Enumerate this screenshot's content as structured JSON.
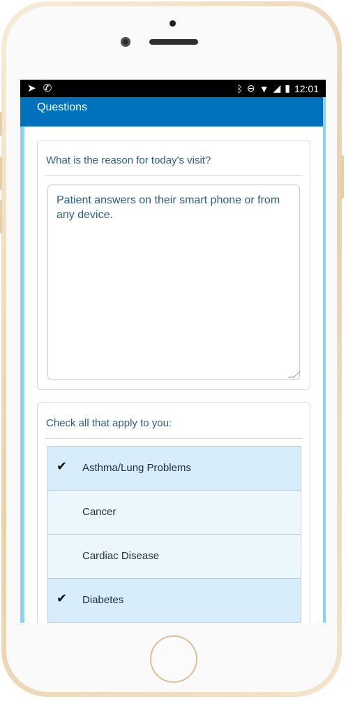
{
  "status_bar": {
    "time": "12:01"
  },
  "app_bar": {
    "title": "Questions"
  },
  "visit_reason": {
    "question": "What is the reason for today's visit?",
    "answer": "Patient answers on their smart phone or from any device."
  },
  "conditions": {
    "question": "Check all that apply to you:",
    "items": [
      {
        "label": "Asthma/Lung Problems",
        "checked": true
      },
      {
        "label": "Cancer",
        "checked": false
      },
      {
        "label": "Cardiac Disease",
        "checked": false
      },
      {
        "label": "Diabetes",
        "checked": true
      }
    ]
  },
  "colors": {
    "app_bar": "#0071bd",
    "text_accent": "#2c5f80",
    "checked_bg": "#d8edfb",
    "unchecked_bg": "#ecf6fd"
  }
}
